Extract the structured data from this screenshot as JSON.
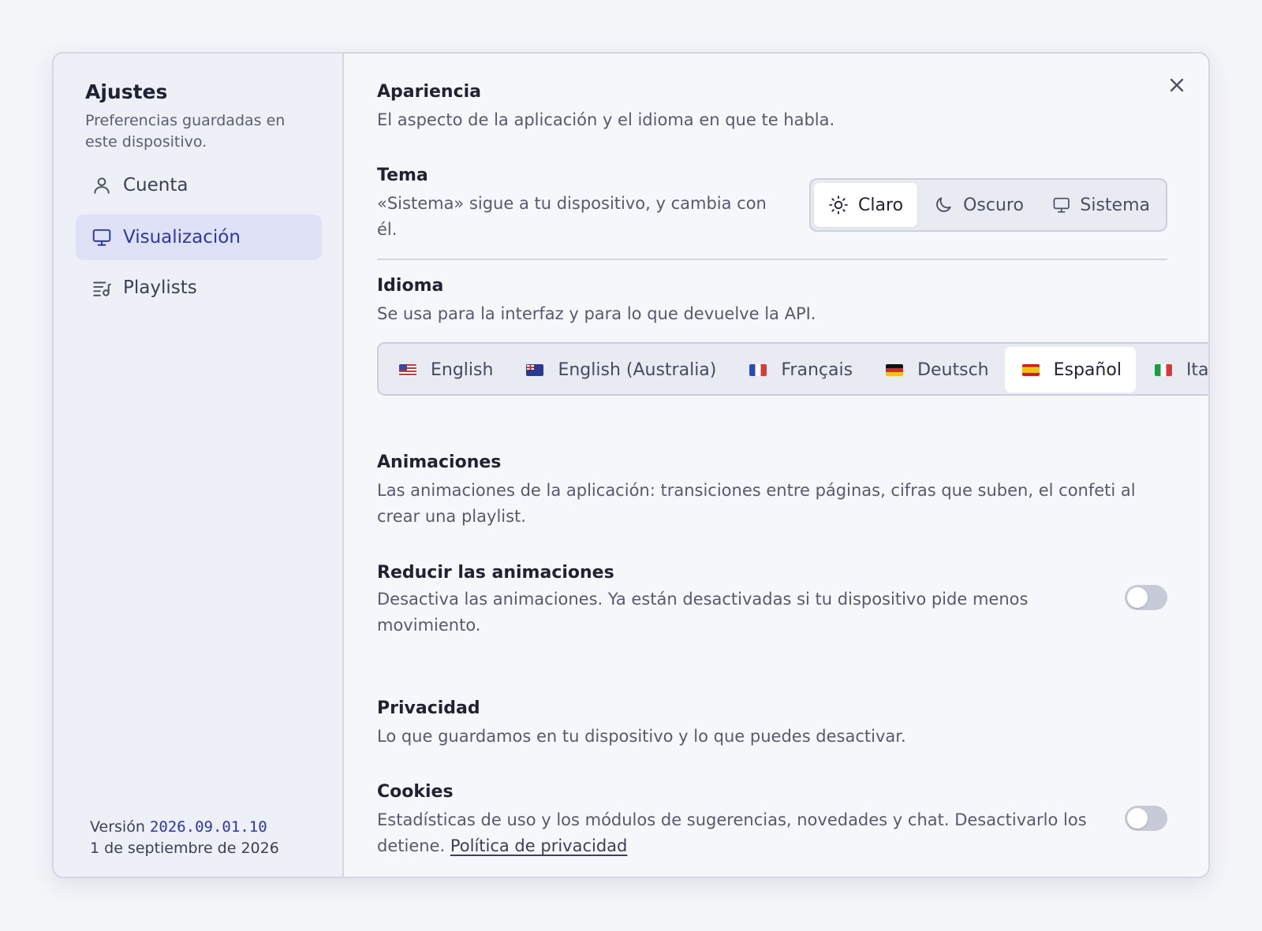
{
  "sidebar": {
    "title": "Ajustes",
    "subtitle": "Preferencias guardadas en este dispositivo.",
    "items": [
      {
        "label": "Cuenta",
        "icon": "user-icon"
      },
      {
        "label": "Visualización",
        "icon": "monitor-icon",
        "active": true
      },
      {
        "label": "Playlists",
        "icon": "playlist-icon"
      }
    ],
    "version_label": "Versión",
    "version_value": "2026.09.01.10",
    "date": "1 de septiembre de 2026"
  },
  "appearance": {
    "title": "Apariencia",
    "description": "El aspecto de la aplicación y el idioma en que te habla."
  },
  "theme": {
    "title": "Tema",
    "description": "«Sistema» sigue a tu dispositivo, y cambia con él.",
    "options": [
      {
        "label": "Claro",
        "icon": "sun-icon",
        "active": true
      },
      {
        "label": "Oscuro",
        "icon": "moon-icon"
      },
      {
        "label": "Sistema",
        "icon": "monitor-icon"
      }
    ]
  },
  "language": {
    "title": "Idioma",
    "description": "Se usa para la interfaz y para lo que devuelve la API.",
    "options": [
      {
        "label": "English",
        "flag": "us-flag"
      },
      {
        "label": "English (Australia)",
        "flag": "au-flag"
      },
      {
        "label": "Français",
        "flag": "fr-flag"
      },
      {
        "label": "Deutsch",
        "flag": "de-flag"
      },
      {
        "label": "Español",
        "flag": "es-flag",
        "active": true
      },
      {
        "label": "Italia",
        "flag": "it-flag"
      }
    ]
  },
  "animations": {
    "title": "Animaciones",
    "description": "Las animaciones de la aplicación: transiciones entre páginas, cifras que suben, el confeti al crear una playlist.",
    "reduce_title": "Reducir las animaciones",
    "reduce_description": "Desactiva las animaciones. Ya están desactivadas si tu dispositivo pide menos movimiento.",
    "reduce_enabled": false
  },
  "privacy": {
    "title": "Privacidad",
    "description": "Lo que guardamos en tu dispositivo y lo que puedes desactivar.",
    "cookies_title": "Cookies",
    "cookies_description": "Estadísticas de uso y los módulos de sugerencias, novedades y chat. Desactivarlo los detiene.",
    "cookies_link": "Política de privacidad",
    "cookies_enabled": false
  },
  "colors": {
    "accent": "#2f37a8",
    "active_nav_bg": "#dfe2f6",
    "toggle_off": "#c7cbd8"
  }
}
